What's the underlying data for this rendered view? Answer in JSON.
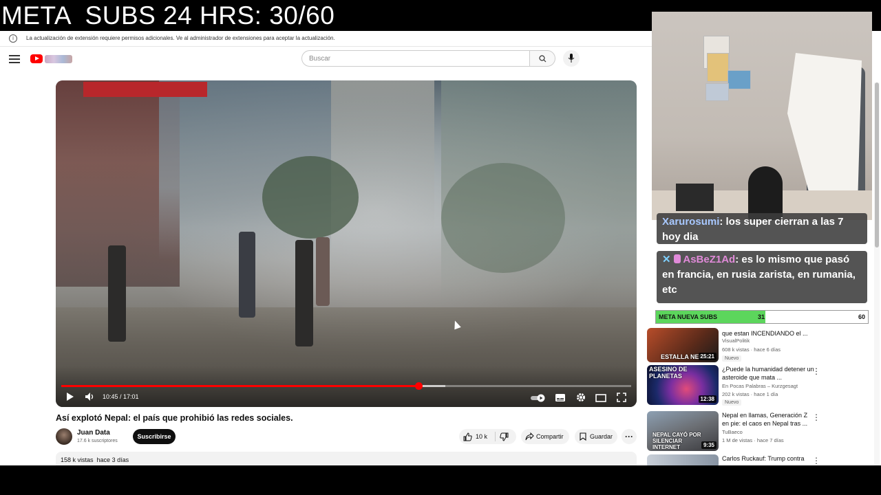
{
  "overlay": {
    "title": "META  SUBS 24 HRS: 30/60"
  },
  "notice": {
    "text": "La actualización de extensión requiere permisos adicionales. Ve al administrador de extensiones para aceptar la actualización."
  },
  "header": {
    "search_placeholder": "Buscar"
  },
  "player": {
    "time": "10:45 / 17:01",
    "progress_fraction": 0.627,
    "buffer_fraction": 0.65
  },
  "video": {
    "title": "Así explotó Nepal: el país que prohibió las redes sociales.",
    "channel": "Juan Data",
    "subscribers": "17.6 k suscriptores",
    "subscribe_label": "Suscribirse",
    "likes": "10 k",
    "share_label": "Compartir",
    "save_label": "Guardar",
    "views": "158 k vistas",
    "posted": "hace 3 días"
  },
  "sidebar": {
    "items": [
      {
        "title": "que estan INCENDIANDO el ...",
        "channel": "VisualPolitik",
        "meta": "608 k vistas · hace 6 días",
        "badge": "Nuevo",
        "duration": "25:21",
        "thumb_text": "ESTALLA NEPAL"
      },
      {
        "title": "¿Puede la humanidad detener un asteroide que mata ...",
        "channel": "En Pocas Palabras – Kurzgesagt",
        "meta": "202 k vistas · hace 1 día",
        "badge": "Nuevo",
        "duration": "12:38",
        "thumb_text": "ASESINO DE PLANETAS"
      },
      {
        "title": "Nepal en llamas, Generación Z en pie: el caos en Nepal tras ...",
        "channel": "TuBaeco",
        "meta": "1 M de vistas · hace 7 días",
        "duration": "9:35",
        "thumb_text": "NEPAL CAYÓ POR SILENCIAR INTERNET"
      },
      {
        "title": "Carlos Ruckauf: Trump contra"
      }
    ]
  },
  "chat": {
    "messages": [
      {
        "user": "Xarurosumi",
        "text": "los super cierran a las 7 hoy dia"
      },
      {
        "user": "AsBeZ1Ad",
        "text": "es lo mismo que pasó en francia, en rusia zarista, en rumania, etc"
      }
    ]
  },
  "goal": {
    "label": "META NUEVA SUBS",
    "current": "31",
    "target": "60",
    "fraction": 0.517,
    "color": "#5cd65c"
  },
  "colors": {
    "accent": "#ff0000",
    "subscribe_bg": "#0f0f0f"
  }
}
